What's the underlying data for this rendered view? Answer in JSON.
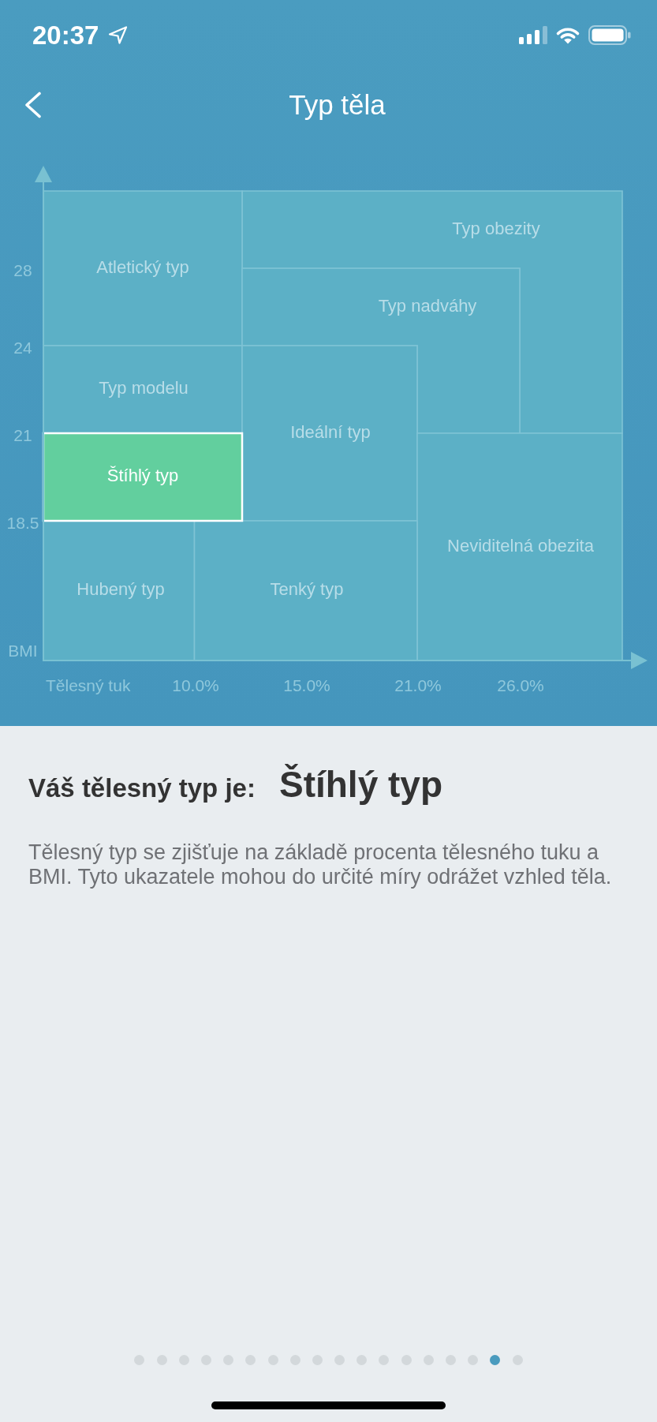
{
  "status_bar": {
    "time": "20:37"
  },
  "nav": {
    "title": "Typ těla"
  },
  "chart": {
    "y_axis": {
      "ticks": [
        "28",
        "24",
        "21",
        "18.5"
      ],
      "label": "BMI"
    },
    "x_axis": {
      "label": "Tělesný tuk",
      "ticks": [
        "10.0%",
        "15.0%",
        "21.0%",
        "26.0%"
      ]
    },
    "regions": [
      {
        "label": "Typ obezity",
        "selected": false
      },
      {
        "label": "Atletický typ",
        "selected": false
      },
      {
        "label": "Typ nadváhy",
        "selected": false
      },
      {
        "label": "Typ modelu",
        "selected": false
      },
      {
        "label": "Ideální typ",
        "selected": false
      },
      {
        "label": "Štíhlý typ",
        "selected": true
      },
      {
        "label": "Neviditelná obezita",
        "selected": false
      },
      {
        "label": "Hubený typ",
        "selected": false
      },
      {
        "label": "Tenký typ",
        "selected": false
      }
    ]
  },
  "result": {
    "label": "Váš tělesný typ je:",
    "value": "Štíhlý typ",
    "description": "Tělesný typ se zjišťuje na základě procenta tělesného tuku a BMI. Tyto ukazatele mohou do určité míry odrážet vzhled těla."
  },
  "pager": {
    "pages": [
      {
        "selected": false
      },
      {
        "selected": false
      },
      {
        "selected": false
      },
      {
        "selected": false
      },
      {
        "selected": false
      },
      {
        "selected": false
      },
      {
        "selected": false
      },
      {
        "selected": false
      },
      {
        "selected": false
      },
      {
        "selected": false
      },
      {
        "selected": false
      },
      {
        "selected": false
      },
      {
        "selected": false
      },
      {
        "selected": false
      },
      {
        "selected": false
      },
      {
        "selected": false
      },
      {
        "selected": true
      },
      {
        "selected": false
      }
    ]
  }
}
